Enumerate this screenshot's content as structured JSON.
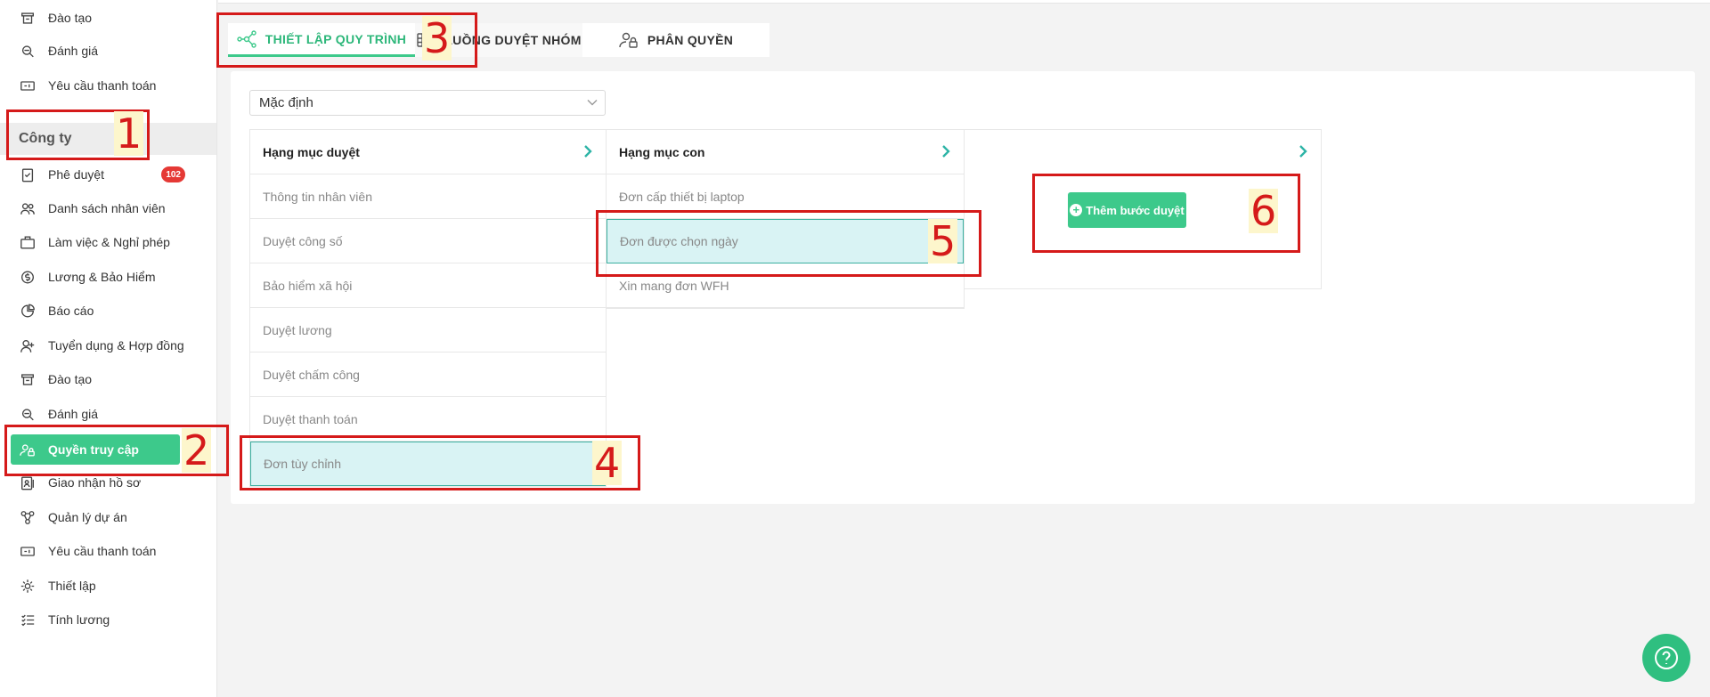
{
  "sidebar": {
    "top_items": [
      {
        "label": "Đào tạo",
        "icon": "training-icon"
      },
      {
        "label": "Đánh giá",
        "icon": "evaluation-icon"
      },
      {
        "label": "Yêu cầu thanh toán",
        "icon": "payment-icon"
      }
    ],
    "section_title": "Công ty",
    "items": [
      {
        "label": "Phê duyệt",
        "icon": "approval-icon",
        "badge": "102"
      },
      {
        "label": "Danh sách nhân viên",
        "icon": "employees-icon"
      },
      {
        "label": "Làm việc & Nghỉ phép",
        "icon": "work-leave-icon"
      },
      {
        "label": "Lương & Bảo Hiểm",
        "icon": "salary-icon"
      },
      {
        "label": "Báo cáo",
        "icon": "report-icon"
      },
      {
        "label": "Tuyển dụng & Hợp đồng",
        "icon": "recruitment-icon"
      },
      {
        "label": "Đào tạo",
        "icon": "training-icon"
      },
      {
        "label": "Đánh giá",
        "icon": "evaluation-icon"
      },
      {
        "label": "Quyền truy cập",
        "icon": "access-icon",
        "active": true
      },
      {
        "label": "Giao nhận hồ sơ",
        "icon": "documents-icon"
      },
      {
        "label": "Quản lý dự án",
        "icon": "project-icon"
      },
      {
        "label": "Yêu cầu thanh toán",
        "icon": "payment-icon"
      },
      {
        "label": "Thiết lập",
        "icon": "settings-icon"
      },
      {
        "label": "Tính lương",
        "icon": "payroll-icon"
      }
    ]
  },
  "tabs": [
    {
      "label": "THIẾT LẬP QUY TRÌNH",
      "icon": "workflow-icon",
      "active": true
    },
    {
      "label": "LUỒNG DUYỆT NHÓM",
      "icon": "table-icon"
    },
    {
      "label": "PHÂN QUYỀN",
      "icon": "user-lock-icon"
    }
  ],
  "dropdown": {
    "value": "Mặc định"
  },
  "columns": {
    "categories": {
      "header": "Hạng mục duyệt",
      "rows": [
        "Thông tin nhân viên",
        "Duyệt công số",
        "Bảo hiểm xã hội",
        "Duyệt lương",
        "Duyệt chấm công",
        "Duyệt thanh toán",
        "Đơn tùy chỉnh"
      ],
      "selected_index": 6
    },
    "subcategories": {
      "header": "Hạng mục con",
      "rows": [
        "Đơn cấp thiết bị laptop",
        "Đơn được chọn ngày",
        "Xin mang đơn WFH"
      ],
      "selected_index": 1
    },
    "steps": {
      "add_button": "Thêm bước duyệt"
    }
  },
  "annotations": [
    "1",
    "2",
    "3",
    "4",
    "5",
    "6"
  ],
  "colors": {
    "accent": "#3dc98b",
    "annotation": "#d51a1a",
    "selected_row": "#d9f3f4",
    "badge": "#e53935"
  }
}
